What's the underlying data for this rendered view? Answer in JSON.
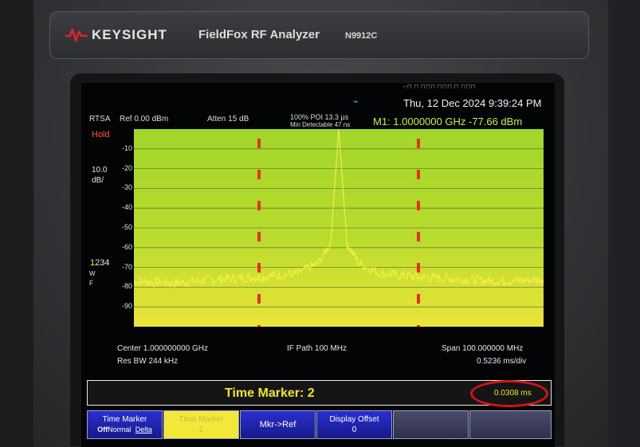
{
  "device": {
    "brand": "KEYSIGHT",
    "product": "FieldFox RF Analyzer",
    "model": "N9912C"
  },
  "status": {
    "datetime": "Thu, 12 Dec 2024 9:39:24 PM",
    "icons_text": "⌐⊓ ⊓ ⊓⊓⊓ ⊓⊓⊓ ⊓ ⊓⊓⊓",
    "mode": "RTSA",
    "ref_level": "Ref 0.00 dBm",
    "attenuation": "Atten 15 dB",
    "poi": "100% POI 13.3 µs",
    "min_detectable": "Min Detectable 47 ns",
    "marker_readout": "M1: 1.0000000 GHz -77.66 dBm",
    "hold": "Hold",
    "scale_value": "10.0",
    "scale_unit": "dB/",
    "trace_one": "1",
    "trace_rest": "234",
    "trace_w": "W",
    "trace_f": "F"
  },
  "plot": {
    "y_ticks": [
      "-10",
      "-20",
      "-30",
      "-40",
      "-50",
      "-60",
      "-70",
      "-80",
      "-90"
    ],
    "colors": {
      "background_top": "#a7d828",
      "background_bottom": "#ece33a",
      "trace": "#f6f046",
      "marker": "#e8311c"
    }
  },
  "chart_data": {
    "type": "line",
    "series": [
      {
        "values": [
          {
            "x": 0.95,
            "y": -77
          },
          {
            "x": 0.96,
            "y": -78
          },
          {
            "x": 0.97,
            "y": -76
          },
          {
            "x": 0.98,
            "y": -75
          },
          {
            "x": 0.99,
            "y": -73
          },
          {
            "x": 0.995,
            "y": -68
          },
          {
            "x": 0.998,
            "y": -58
          },
          {
            "x": 1.0,
            "y": 0
          },
          {
            "x": 1.002,
            "y": -58
          },
          {
            "x": 1.005,
            "y": -68
          },
          {
            "x": 1.01,
            "y": -73
          },
          {
            "x": 1.02,
            "y": -75
          },
          {
            "x": 1.03,
            "y": -76
          },
          {
            "x": 1.04,
            "y": -77
          },
          {
            "x": 1.05,
            "y": -76
          }
        ]
      }
    ],
    "ylim": [
      -100,
      0
    ],
    "grid": true
  },
  "footer": {
    "center": "Center 1.000000000 GHz",
    "if_path": "IF Path 100 MHz",
    "span": "Span 100.000000 MHz",
    "rbw": "Res BW 244 kHz",
    "sweep": "0.5236 ms/div"
  },
  "time_marker": {
    "title": "Time Marker: 2",
    "value": "0.0308 ms"
  },
  "softkeys": {
    "time_marker_label": "Time Marker",
    "time_marker_off": "Off",
    "time_marker_normal": "Normal",
    "time_marker_delta": "Delta",
    "time_marker2_label": "Time Marker",
    "time_marker2_value": "2",
    "mkr_ref": "Mkr->Ref",
    "display_offset_label": "Display Offset",
    "display_offset_value": "0"
  }
}
